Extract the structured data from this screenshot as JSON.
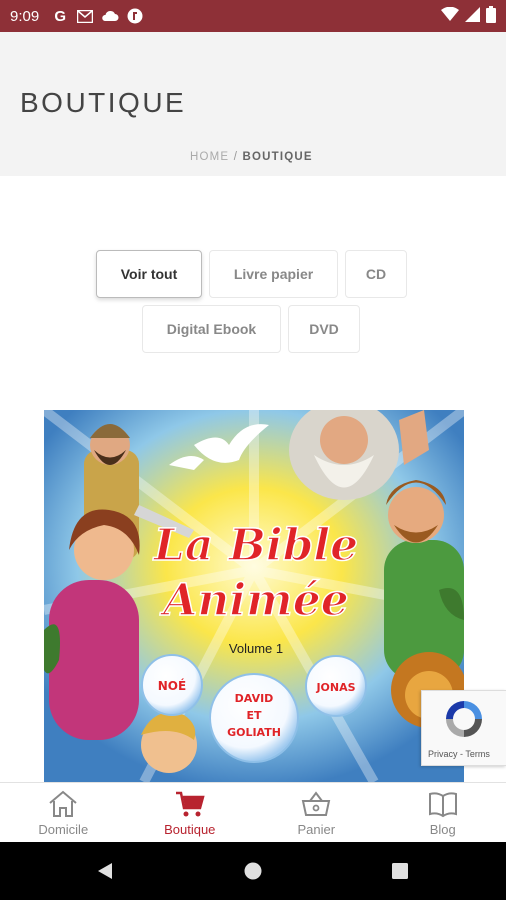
{
  "status_bar": {
    "time": "9:09",
    "notification_icons": [
      "google-icon",
      "gmail-icon",
      "cloud-icon",
      "app-icon"
    ],
    "right_icons": [
      "wifi-icon",
      "signal-icon",
      "battery-icon"
    ]
  },
  "header": {
    "title": "BOUTIQUE"
  },
  "breadcrumb": {
    "home": "HOME",
    "separator": " / ",
    "current": "BOUTIQUE"
  },
  "filters": [
    {
      "label": "Voir tout",
      "active": true
    },
    {
      "label": "Livre papier",
      "active": false
    },
    {
      "label": "CD",
      "active": false
    },
    {
      "label": "Digital Ebook",
      "active": false
    },
    {
      "label": "DVD",
      "active": false
    }
  ],
  "product": {
    "cover_title_line1": "La Bible",
    "cover_title_line2": "Animée",
    "volume": "Volume 1",
    "bubbles": [
      "NOÉ",
      "DAVID ET GOLIATH",
      "JONAS"
    ]
  },
  "recaptcha": {
    "text": "Privacy - Terms"
  },
  "bottom_nav": [
    {
      "label": "Domicile",
      "icon": "home-icon",
      "active": false
    },
    {
      "label": "Boutique",
      "icon": "cart-icon",
      "active": true
    },
    {
      "label": "Panier",
      "icon": "basket-icon",
      "active": false
    },
    {
      "label": "Blog",
      "icon": "book-icon",
      "active": false
    }
  ],
  "colors": {
    "status_bar": "#8e3037",
    "accent": "#b8232f",
    "header_bg": "#f3f3f3"
  }
}
